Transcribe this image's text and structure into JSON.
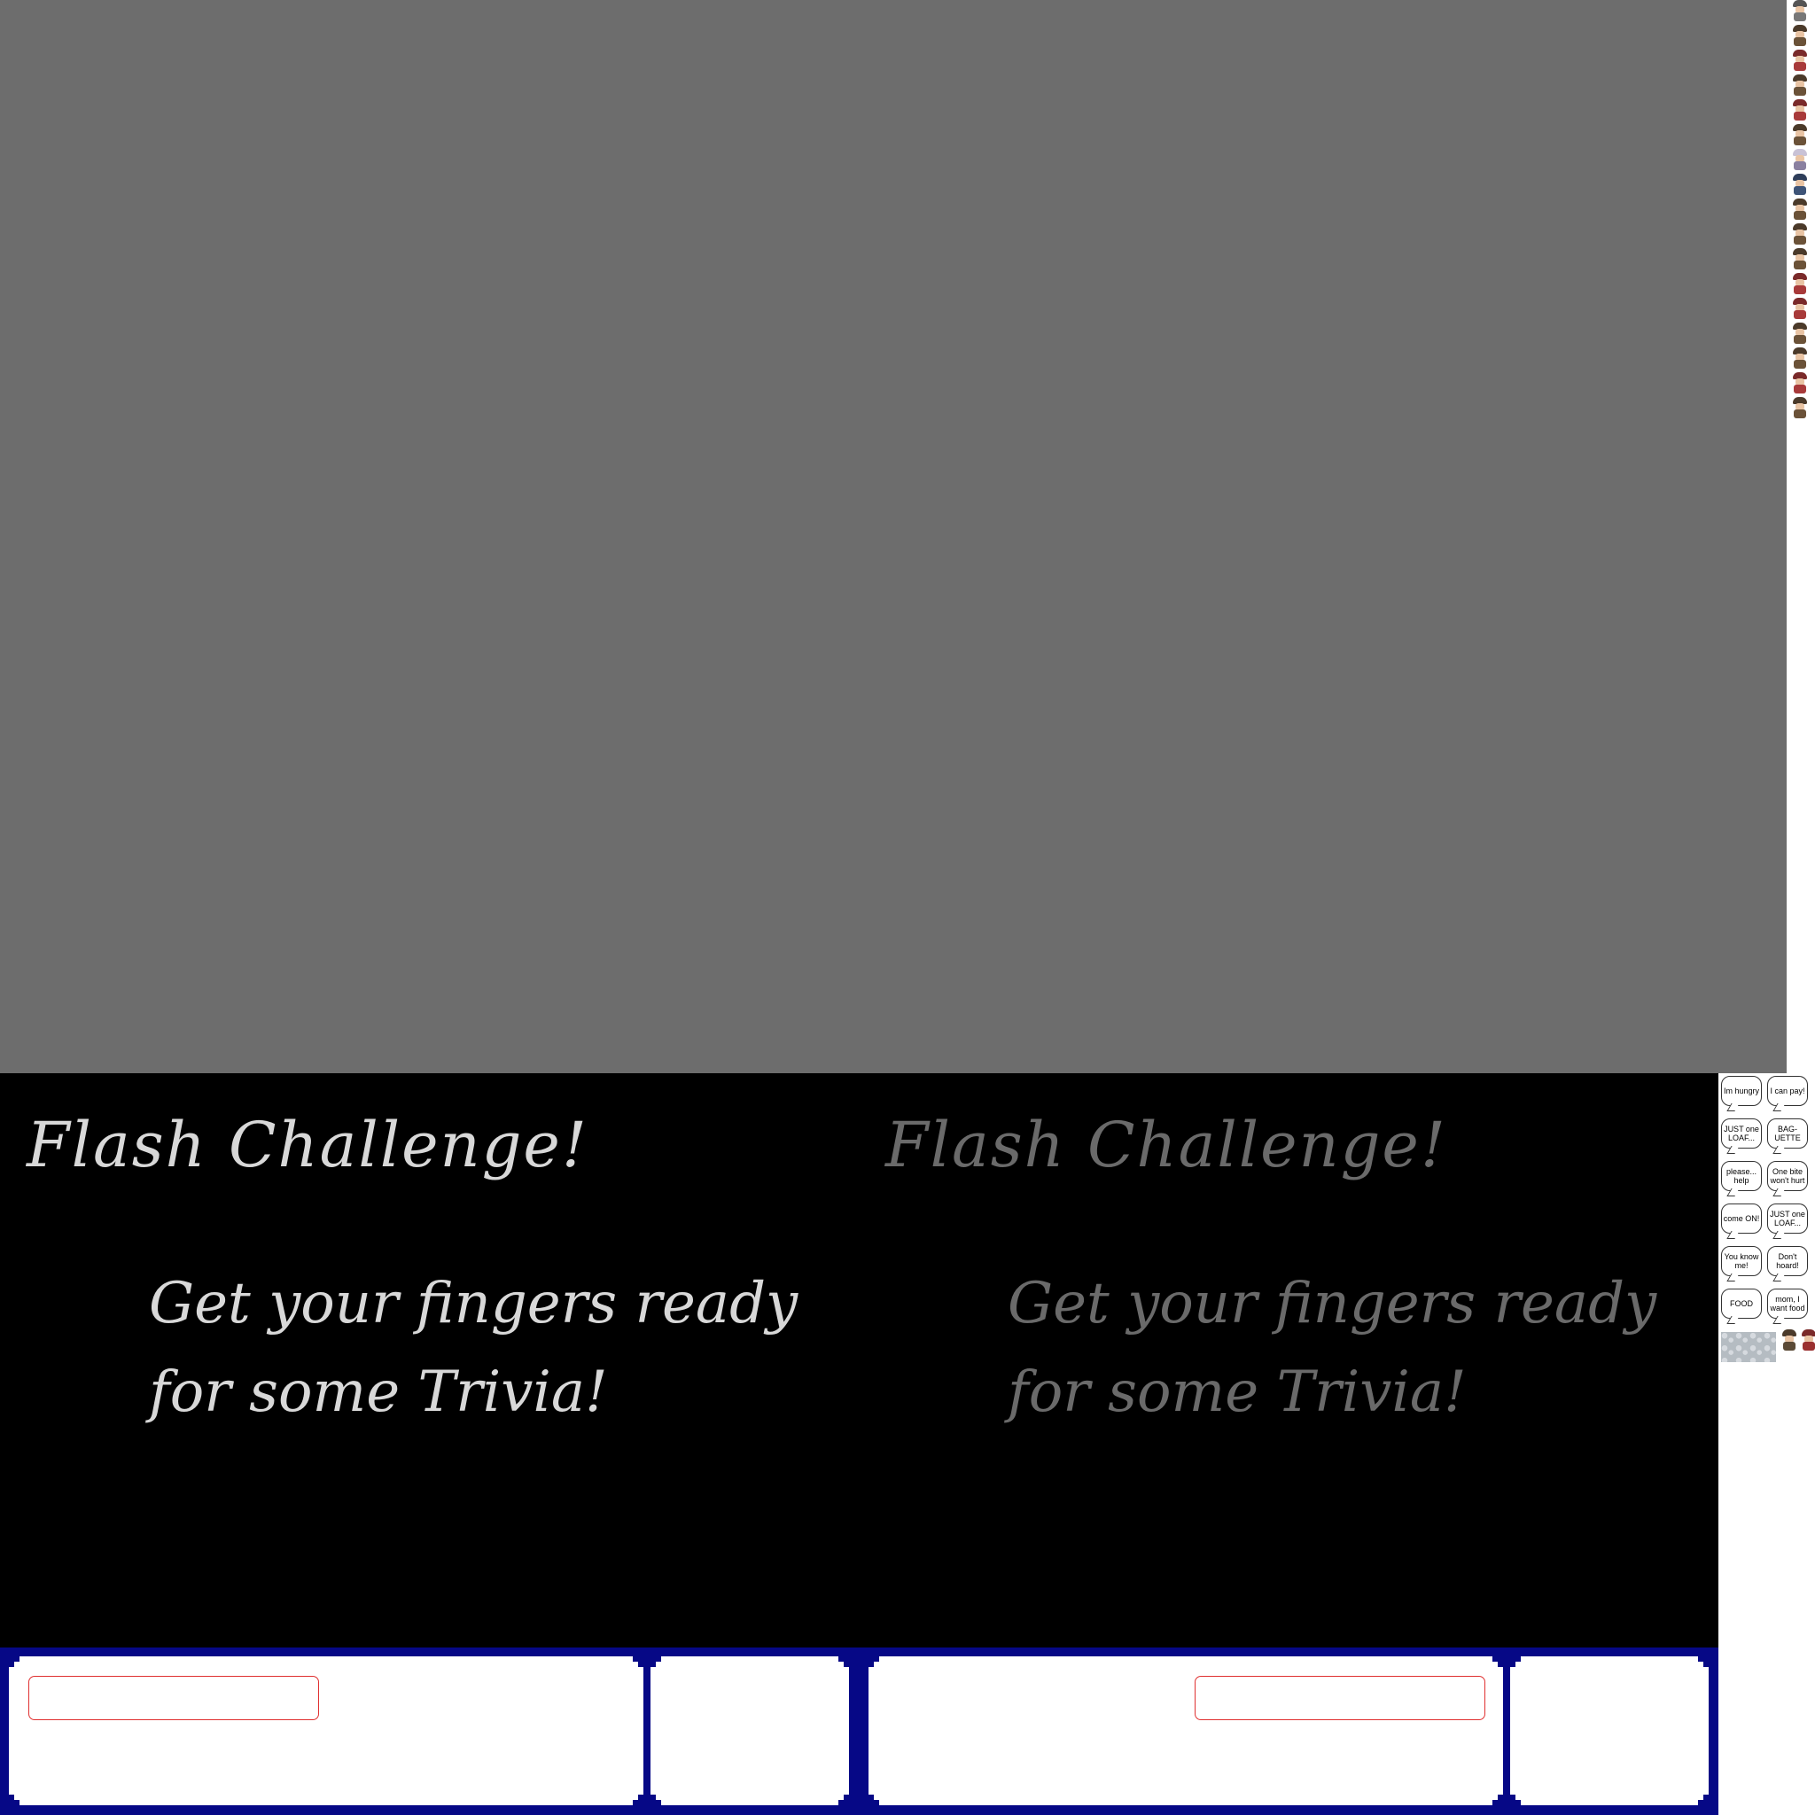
{
  "slides": [
    {
      "title": "Flash Challenge!",
      "subtitle": "Get your fingers ready\nfor some Trivia!",
      "text_color": "#d8d8d8"
    },
    {
      "title": "Flash Challenge!",
      "subtitle": "Get your fingers ready\nfor some Trivia!",
      "text_color": "#6a6a6a"
    }
  ],
  "speech_bubbles": [
    "Im hungry",
    "I can pay!",
    "JUST one LOAF...",
    "BAG-UETTE",
    "please... help",
    "One bite won't hurt",
    "come ON!",
    "JUST one LOAF...",
    "You know me!",
    "Don't hoard!",
    "FOOD",
    "mom, I want food"
  ],
  "colors": {
    "gray_panel": "#6d6d6d",
    "black_panel": "#000000",
    "ui_frame_blue": "#060886",
    "input_border": "#e03030"
  },
  "character_sprites": [
    "gray",
    "brown",
    "red",
    "brown",
    "red",
    "brown",
    "pale",
    "blue",
    "brown",
    "brown",
    "brown",
    "red",
    "red",
    "brown",
    "brown",
    "red",
    "brown"
  ]
}
